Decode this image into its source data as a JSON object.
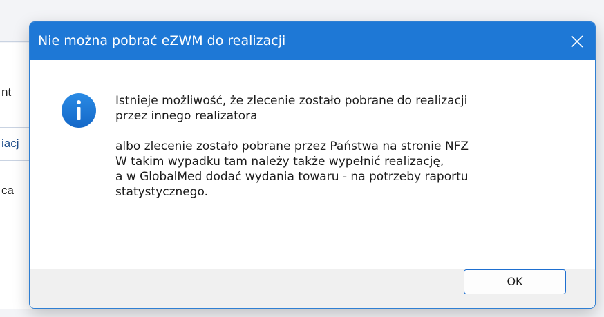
{
  "background": {
    "fragments": [
      "nt",
      "iacj",
      "ca"
    ]
  },
  "dialog": {
    "title": "Nie można pobrać eZWM do realizacji",
    "close_icon": "close-icon",
    "icon": "info-icon",
    "accent_color": "#1e78d6",
    "message_lines_1": [
      "Istnieje możliwość, że zlecenie zostało pobrane do realizacji",
      "przez innego realizatora"
    ],
    "message_lines_2": [
      "albo zlecenie zostało pobrane przez Państwa na stronie NFZ",
      "W takim wypadku tam należy także wypełnić realizację,",
      "a w GlobalMed dodać wydania towaru - na potrzeby raportu",
      "statystycznego."
    ],
    "ok_label": "OK"
  }
}
